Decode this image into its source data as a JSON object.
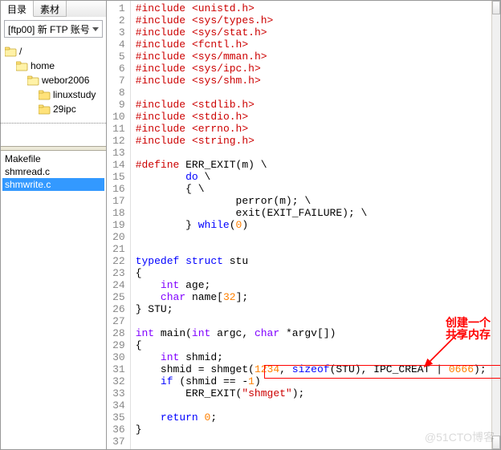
{
  "tabs": {
    "t1": "目录",
    "t2": "素材"
  },
  "dropdown": {
    "label": "[ftp00] 新 FTP 账号"
  },
  "tree": [
    {
      "label": "/",
      "indent": 0,
      "open": true
    },
    {
      "label": "home",
      "indent": 1,
      "open": true
    },
    {
      "label": "webor2006",
      "indent": 2,
      "open": true
    },
    {
      "label": "linuxstudy",
      "indent": 3,
      "open": false
    },
    {
      "label": "29ipc",
      "indent": 3,
      "open": false,
      "sel": false
    }
  ],
  "files": [
    {
      "name": "Makefile",
      "sel": false
    },
    {
      "name": "shmread.c",
      "sel": false
    },
    {
      "name": "shmwrite.c",
      "sel": true
    }
  ],
  "annotations": {
    "comment": "创建一个共享内存"
  },
  "watermark": "@51CTO博客",
  "code": [
    {
      "n": 1,
      "h": "<span class=\"pp\">#include</span> <span class=\"str\">&lt;unistd.h&gt;</span>"
    },
    {
      "n": 2,
      "h": "<span class=\"pp\">#include</span> <span class=\"str\">&lt;sys/types.h&gt;</span>"
    },
    {
      "n": 3,
      "h": "<span class=\"pp\">#include</span> <span class=\"str\">&lt;sys/stat.h&gt;</span>"
    },
    {
      "n": 4,
      "h": "<span class=\"pp\">#include</span> <span class=\"str\">&lt;fcntl.h&gt;</span>"
    },
    {
      "n": 5,
      "h": "<span class=\"pp\">#include</span> <span class=\"str\">&lt;sys/mman.h&gt;</span>"
    },
    {
      "n": 6,
      "h": "<span class=\"pp\">#include</span> <span class=\"str\">&lt;sys/ipc.h&gt;</span>"
    },
    {
      "n": 7,
      "h": "<span class=\"pp\">#include</span> <span class=\"str\">&lt;sys/shm.h&gt;</span>"
    },
    {
      "n": 8,
      "h": ""
    },
    {
      "n": 9,
      "h": "<span class=\"pp\">#include</span> <span class=\"str\">&lt;stdlib.h&gt;</span>"
    },
    {
      "n": 10,
      "h": "<span class=\"pp\">#include</span> <span class=\"str\">&lt;stdio.h&gt;</span>"
    },
    {
      "n": 11,
      "h": "<span class=\"pp\">#include</span> <span class=\"str\">&lt;errno.h&gt;</span>"
    },
    {
      "n": 12,
      "h": "<span class=\"pp\">#include</span> <span class=\"str\">&lt;string.h&gt;</span>"
    },
    {
      "n": 13,
      "h": ""
    },
    {
      "n": 14,
      "h": "<span class=\"pp\">#define</span> ERR_EXIT(m) \\"
    },
    {
      "n": 15,
      "h": "        <span class=\"kw\">do</span> \\"
    },
    {
      "n": 16,
      "h": "        { \\"
    },
    {
      "n": 17,
      "h": "                perror(m); \\"
    },
    {
      "n": 18,
      "h": "                exit(EXIT_FAILURE); \\"
    },
    {
      "n": 19,
      "h": "        } <span class=\"kw\">while</span>(<span class=\"num\">0</span>)"
    },
    {
      "n": 20,
      "h": ""
    },
    {
      "n": 21,
      "h": ""
    },
    {
      "n": 22,
      "h": "<span class=\"kw\">typedef</span> <span class=\"kw\">struct</span> stu"
    },
    {
      "n": 23,
      "h": "{"
    },
    {
      "n": 24,
      "h": "    <span class=\"type\">int</span> age;"
    },
    {
      "n": 25,
      "h": "    <span class=\"type\">char</span> name[<span class=\"num\">32</span>];"
    },
    {
      "n": 26,
      "h": "} STU;"
    },
    {
      "n": 27,
      "h": ""
    },
    {
      "n": 28,
      "h": "<span class=\"type\">int</span> main(<span class=\"type\">int</span> argc, <span class=\"type\">char</span> *argv[])"
    },
    {
      "n": 29,
      "h": "{"
    },
    {
      "n": 30,
      "h": "    <span class=\"type\">int</span> shmid;"
    },
    {
      "n": 31,
      "h": "    shmid = shmget(<span class=\"num\">1234</span>, <span class=\"kw\">sizeof</span>(STU), IPC_CREAT | <span class=\"num\">0666</span>);"
    },
    {
      "n": 32,
      "h": "    <span class=\"kw\">if</span> (shmid == -<span class=\"num\">1</span>)"
    },
    {
      "n": 33,
      "h": "        ERR_EXIT(<span class=\"str\">\"shmget\"</span>);"
    },
    {
      "n": 34,
      "h": ""
    },
    {
      "n": 35,
      "h": "    <span class=\"kw\">return</span> <span class=\"num\">0</span>;"
    },
    {
      "n": 36,
      "h": "}"
    },
    {
      "n": 37,
      "h": ""
    }
  ]
}
